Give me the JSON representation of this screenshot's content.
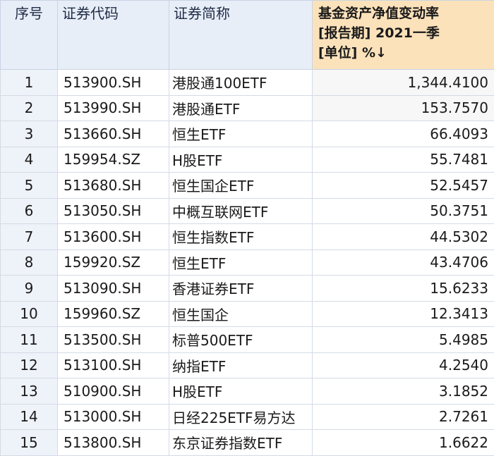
{
  "table": {
    "headers": {
      "seq": "序号",
      "code": "证券代码",
      "name": "证券简称",
      "metric_line1": "基金资产净值变动率",
      "metric_line2": "[报告期] 2021一季",
      "metric_line3": "[单位] %↓"
    },
    "rows": [
      {
        "seq": "1",
        "code": "513900.SH",
        "name": "港股通100ETF",
        "value": "1,344.4100"
      },
      {
        "seq": "2",
        "code": "513990.SH",
        "name": "港股通ETF",
        "value": "153.7570"
      },
      {
        "seq": "3",
        "code": "513660.SH",
        "name": "恒生ETF",
        "value": "66.4093"
      },
      {
        "seq": "4",
        "code": "159954.SZ",
        "name": "H股ETF",
        "value": "55.7481"
      },
      {
        "seq": "5",
        "code": "513680.SH",
        "name": "恒生国企ETF",
        "value": "52.5457"
      },
      {
        "seq": "6",
        "code": "513050.SH",
        "name": "中概互联网ETF",
        "value": "50.3751"
      },
      {
        "seq": "7",
        "code": "513600.SH",
        "name": "恒生指数ETF",
        "value": "44.5302"
      },
      {
        "seq": "8",
        "code": "159920.SZ",
        "name": "恒生ETF",
        "value": "43.4706"
      },
      {
        "seq": "9",
        "code": "513090.SH",
        "name": "香港证券ETF",
        "value": "15.6233"
      },
      {
        "seq": "10",
        "code": "159960.SZ",
        "name": "恒生国企",
        "value": "12.3413"
      },
      {
        "seq": "11",
        "code": "513500.SH",
        "name": "标普500ETF",
        "value": "5.4985"
      },
      {
        "seq": "12",
        "code": "513100.SH",
        "name": "纳指ETF",
        "value": "4.2540"
      },
      {
        "seq": "13",
        "code": "510900.SH",
        "name": "H股ETF",
        "value": "3.1852"
      },
      {
        "seq": "14",
        "code": "513000.SH",
        "name": "日经225ETF易方达",
        "value": "2.7261"
      },
      {
        "seq": "15",
        "code": "513800.SH",
        "name": "东京证券指数ETF",
        "value": "1.6622"
      }
    ]
  }
}
